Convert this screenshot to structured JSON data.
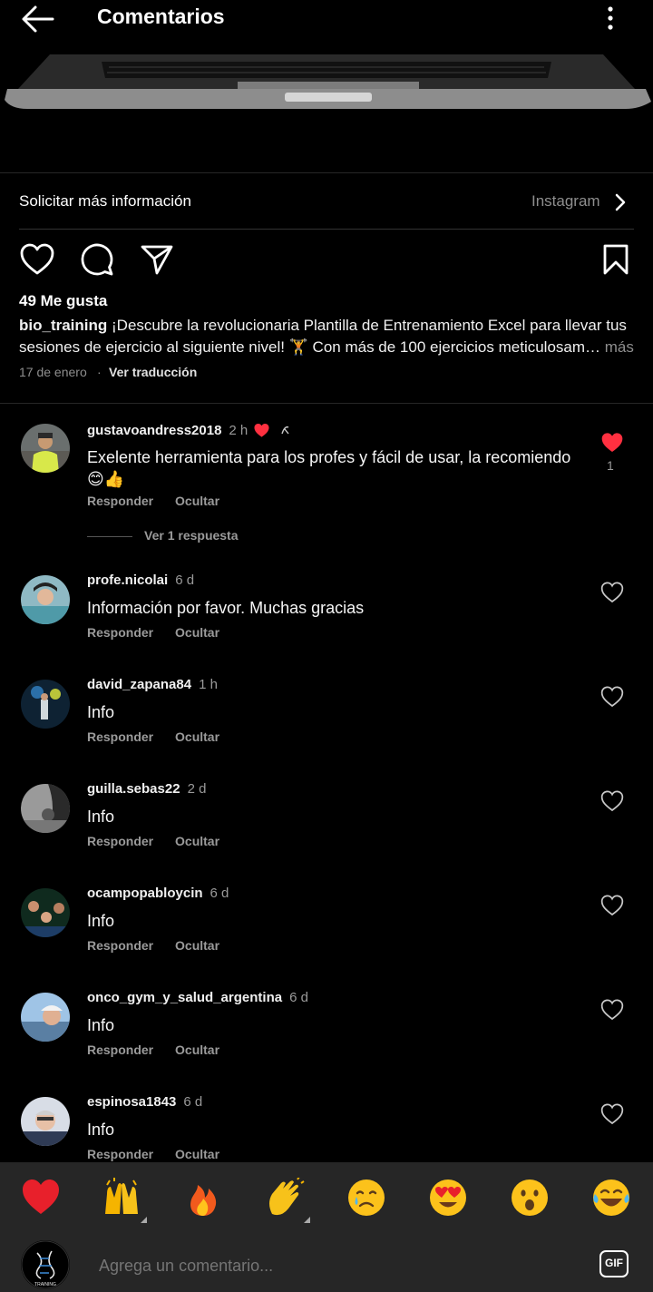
{
  "header": {
    "title": "Comentarios"
  },
  "cta": {
    "label": "Solicitar más información",
    "source": "Instagram"
  },
  "post": {
    "likes": "49 Me gusta",
    "username": "bio_training",
    "caption": "¡Descubre la revolucionaria Plantilla de Entrenamiento Excel para llevar tus sesiones de ejercicio al siguiente nivel! 🏋 Con más de 100 ejercicios meticulosam…",
    "more": "más",
    "date": "17 de enero",
    "separator": "·",
    "translate": "Ver traducción"
  },
  "comments": [
    {
      "user": "gustavoandress2018",
      "time": "2 h",
      "text": "Exelente herramienta para los profes y fácil de usar, la recomiendo 😊👍",
      "reply": "Responder",
      "hide": "Ocultar",
      "liked": true,
      "like_count": "1",
      "replies_label": "Ver 1 respuesta"
    },
    {
      "user": "profe.nicolai",
      "time": "6 d",
      "text": "Información por favor. Muchas gracias",
      "reply": "Responder",
      "hide": "Ocultar",
      "liked": false
    },
    {
      "user": "david_zapana84",
      "time": "1 h",
      "text": "Info",
      "reply": "Responder",
      "hide": "Ocultar",
      "liked": false
    },
    {
      "user": "guilla.sebas22",
      "time": "2 d",
      "text": "Info",
      "reply": "Responder",
      "hide": "Ocultar",
      "liked": false
    },
    {
      "user": "ocampopabloycin",
      "time": "6 d",
      "text": "Info",
      "reply": "Responder",
      "hide": "Ocultar",
      "liked": false
    },
    {
      "user": "onco_gym_y_salud_argentina",
      "time": "6 d",
      "text": "Info",
      "reply": "Responder",
      "hide": "Ocultar",
      "liked": false
    },
    {
      "user": "espinosa1843",
      "time": "6 d",
      "text": "Info",
      "reply": "Responder",
      "hide": "Ocultar",
      "liked": false
    }
  ],
  "quick_reactions": [
    "❤️",
    "🙌",
    "🔥",
    "👏",
    "😢",
    "😍",
    "😮",
    "😂"
  ],
  "composer": {
    "placeholder": "Agrega un comentario...",
    "gif_label": "GIF",
    "avatar_text": "TRAINING"
  },
  "colors": {
    "background": "#000000",
    "like_red": "#ff3040",
    "muted_text": "#8e8e8e",
    "bottom_bar": "#262626"
  }
}
